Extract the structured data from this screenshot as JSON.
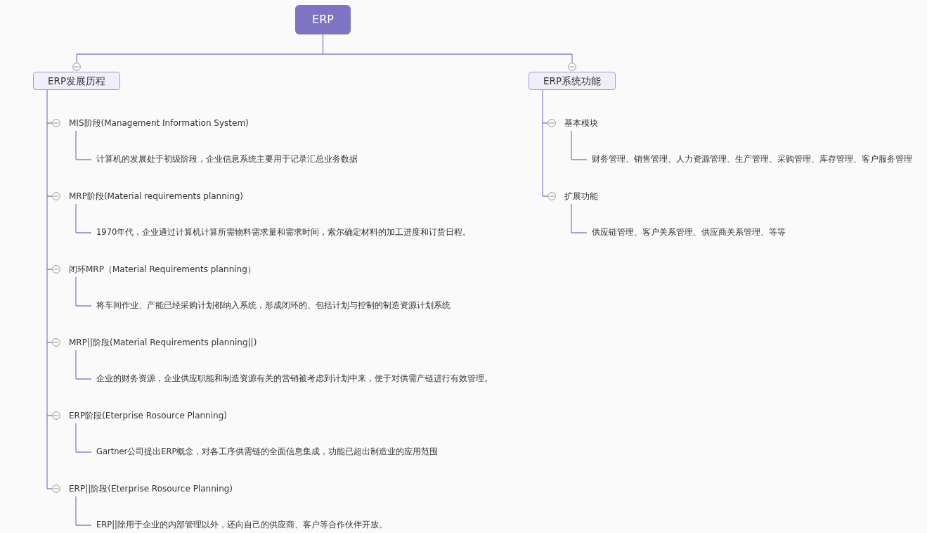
{
  "root": {
    "label": "ERP"
  },
  "branches": [
    {
      "label": "ERP发展历程",
      "expanded": true,
      "children": [
        {
          "label": "MIS阶段(Management Information System)",
          "expanded": true,
          "children": [
            {
              "label": "计算机的发展处于初级阶段，企业信息系统主要用于记录汇总业务数据"
            }
          ]
        },
        {
          "label": "MRP阶段(Material requirements planning)",
          "expanded": true,
          "children": [
            {
              "label": "1970年代，企业通过计算机计算所需物料需求量和需求时间，索尔确定材料的加工进度和订货日程。"
            }
          ]
        },
        {
          "label": "闭环MRP（Material Requirements planning）",
          "expanded": true,
          "children": [
            {
              "label": "将车间作业、产能已经采购计划都纳入系统，形成闭环的、包括计划与控制的制造资源计划系统"
            }
          ]
        },
        {
          "label": "MRP||阶段(Material Requirements planning||)",
          "expanded": true,
          "children": [
            {
              "label": "企业的财务资源，企业供应职能和制造资源有关的营销被考虑到计划中来，便于对供需产链进行有效管理。"
            }
          ]
        },
        {
          "label": "ERP阶段(Eterprise Rosource Planning)",
          "expanded": true,
          "children": [
            {
              "label": "Gartner公司提出ERP概念，对各工序供需链的全面信息集成，功能已超出制造业的应用范围"
            }
          ]
        },
        {
          "label": "ERP||阶段(Eterprise Rosource Planning)",
          "expanded": true,
          "children": [
            {
              "label": "ERP||除用于企业的内部管理以外，还向自己的供应商、客户等合作伙伴开放。"
            }
          ]
        }
      ]
    },
    {
      "label": "ERP系统功能",
      "expanded": true,
      "children": [
        {
          "label": "基本模块",
          "expanded": true,
          "children": [
            {
              "label": "财务管理、销售管理、人力资源管理、生产管理、采购管理、库存管理、客户服务管理"
            }
          ]
        },
        {
          "label": "扩展功能",
          "expanded": true,
          "children": [
            {
              "label": "供应链管理、客户关系管理、供应商关系管理、等等"
            }
          ]
        }
      ]
    }
  ]
}
